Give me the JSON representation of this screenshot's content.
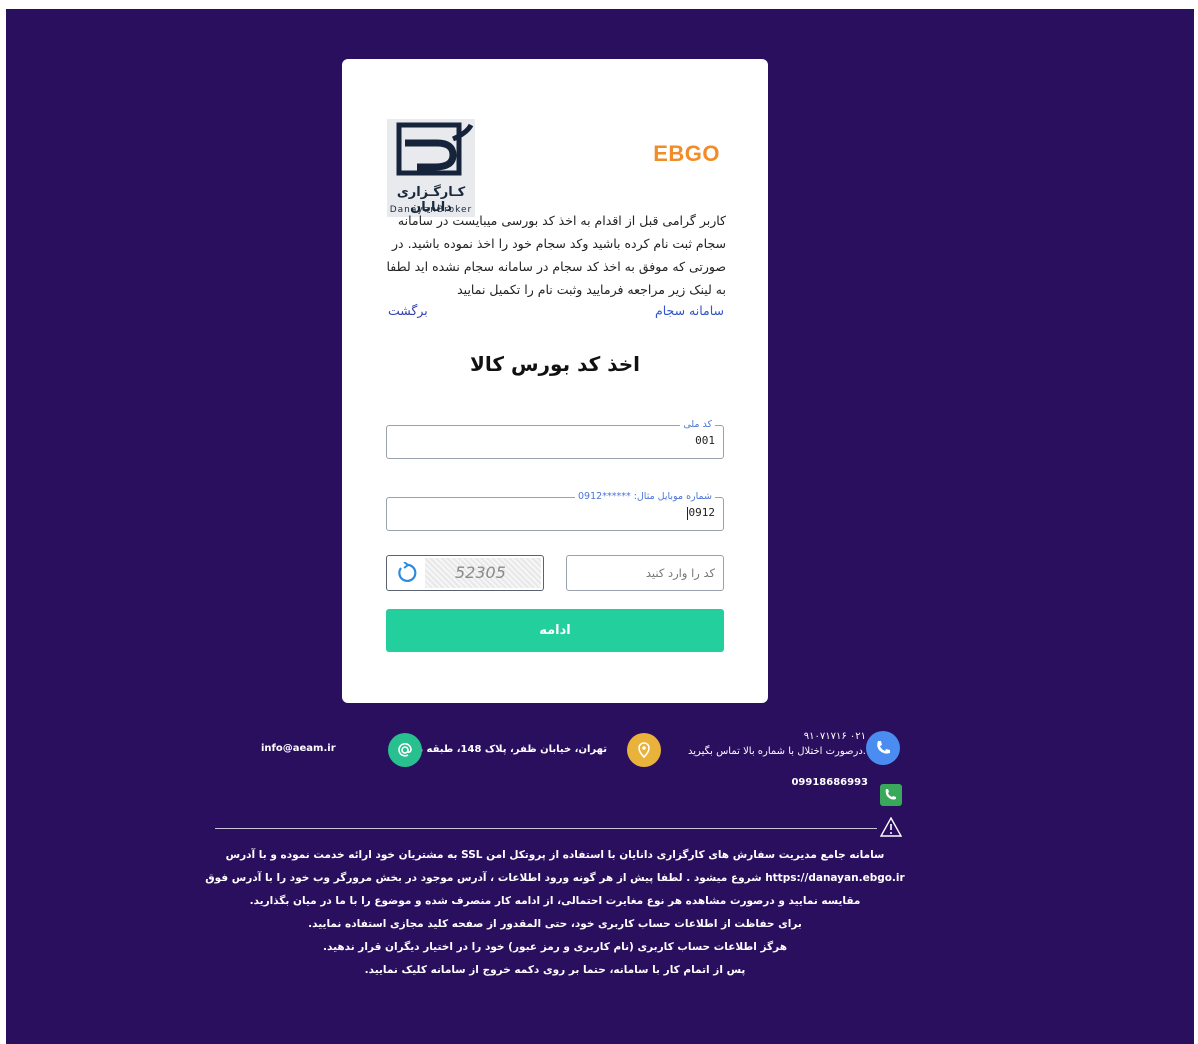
{
  "logos": {
    "danayan_fa": "کـارگـزاری دانایان",
    "danayan_en": "DanayanBroker",
    "ebgo": "EBGO"
  },
  "notice": {
    "text": "کاربر گرامی قبل از اقدام به اخذ کد بورسی میبایست در سامانه سجام ثبت نام کرده باشید وکد سجام خود را اخذ نموده باشید. در صورتی که موفق به اخذ کد سجام در سامانه سجام نشده اید لطفا به لینک زیر مراجعه فرمایید وثبت نام را تکمیل نمایید",
    "sajam_link": "سامانه سجام",
    "back_link": "برگشت"
  },
  "form": {
    "title": "اخذ کد بورس کالا",
    "national_code": {
      "label": "کد ملی",
      "value": "001"
    },
    "mobile": {
      "label": "شماره موبایل مثال: ******0912",
      "value": "0912"
    },
    "captcha": {
      "code": "52305",
      "placeholder": "کد  را وارد کنید"
    },
    "submit_label": "ادامه"
  },
  "footer": {
    "phone": "۰۲۱ ۹۱۰۷۱۷۱۶",
    "phone_note": ".درصورت اختلال با شماره بالا تماس بگیرید",
    "mobile": "09918686993",
    "address": "تهران، خیابان ظفر، پلاک 148، طبقه دوم",
    "email": "info@aeam.ir",
    "colors": {
      "phone": "#4a8cf0",
      "whatsapp": "#39a85a",
      "address": "#e9b23a",
      "email": "#27c08e"
    }
  },
  "disclaimer": [
    "سامانه جامع مدیریت سفارش های کارگزاری دانایان با استفاده از پروتکل امن SSL به مشتریان خود ارائه خدمت نموده و با آدرس https://danayan.ebgo.ir شروع میشود . لطفا پیش از هر گونه ورود اطلاعات ، آدرس موجود در بخش مرورگر وب خود را با آدرس فوق مقایسه نمایید و درصورت مشاهده هر نوع مغایرت احتمالی، از ادامه کار منصرف شده و موضوع را با ما در میان بگذارید.",
    "برای حفاظت از اطلاعات حساب کاربری خود، حتی المقدور از صفحه کلید مجازی استفاده نمایید.",
    "هرگز اطلاعات حساب کاربری (نام کاربری و رمز عبور) خود را در اختیار دیگران قرار ندهید.",
    "پس از اتمام کار با سامانه، حتما بر روی دکمه خروج از سامانه کلیک نمایید."
  ]
}
